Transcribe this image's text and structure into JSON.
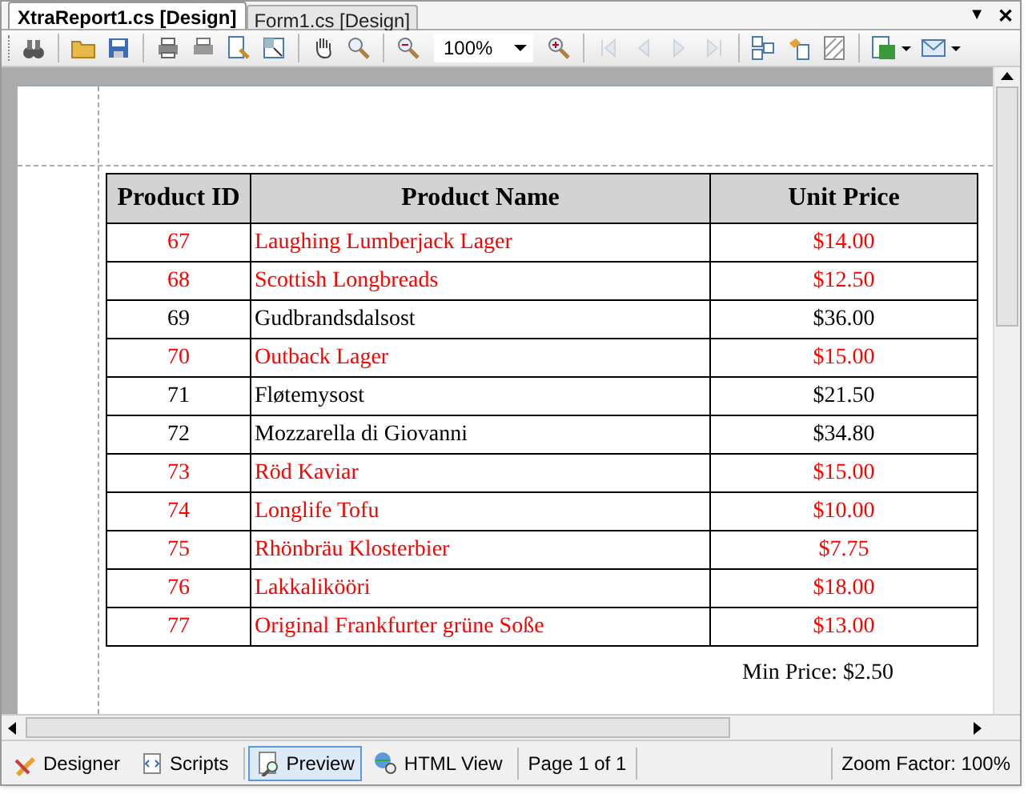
{
  "tabs": [
    {
      "label": "XtraReport1.cs [Design]",
      "selected": true
    },
    {
      "label": "Form1.cs [Design]",
      "selected": false
    }
  ],
  "tab_controls": {
    "menu": "▼",
    "close": "✕"
  },
  "toolbar": [
    {
      "kind": "button",
      "disabled": false
    },
    {
      "kind": "separator"
    },
    {
      "kind": "button",
      "disabled": false
    },
    {
      "kind": "button",
      "disabled": false
    },
    {
      "kind": "separator"
    },
    {
      "kind": "button",
      "disabled": false
    },
    {
      "kind": "button",
      "disabled": false
    },
    {
      "kind": "button",
      "disabled": false
    },
    {
      "kind": "button",
      "disabled": false
    },
    {
      "kind": "separator"
    },
    {
      "kind": "button",
      "disabled": false
    },
    {
      "kind": "button",
      "disabled": false
    },
    {
      "kind": "separator"
    },
    {
      "kind": "button",
      "disabled": false
    },
    {
      "kind": "combo",
      "value": "100%"
    },
    {
      "kind": "button",
      "disabled": false
    },
    {
      "kind": "separator"
    },
    {
      "kind": "button",
      "disabled": true
    },
    {
      "kind": "button",
      "disabled": true
    },
    {
      "kind": "button",
      "disabled": true
    },
    {
      "kind": "button",
      "disabled": true
    },
    {
      "kind": "separator"
    },
    {
      "kind": "button",
      "disabled": false
    },
    {
      "kind": "button",
      "disabled": false
    },
    {
      "kind": "button",
      "disabled": false
    },
    {
      "kind": "separator"
    },
    {
      "kind": "dropdown",
      "disabled": false
    },
    {
      "kind": "dropdown",
      "disabled": false
    }
  ],
  "table": {
    "columns": [
      "Product ID",
      "Product Name",
      "Unit Price"
    ],
    "rows": [
      {
        "id": "67",
        "name": "Laughing Lumberjack Lager",
        "price": "$14.00",
        "highlighted": true
      },
      {
        "id": "68",
        "name": "Scottish Longbreads",
        "price": "$12.50",
        "highlighted": true
      },
      {
        "id": "69",
        "name": "Gudbrandsdalsost",
        "price": "$36.00",
        "highlighted": false
      },
      {
        "id": "70",
        "name": "Outback Lager",
        "price": "$15.00",
        "highlighted": true
      },
      {
        "id": "71",
        "name": "Fløtemysost",
        "price": "$21.50",
        "highlighted": false
      },
      {
        "id": "72",
        "name": "Mozzarella di Giovanni",
        "price": "$34.80",
        "highlighted": false
      },
      {
        "id": "73",
        "name": "Röd Kaviar",
        "price": "$15.00",
        "highlighted": true
      },
      {
        "id": "74",
        "name": "Longlife Tofu",
        "price": "$10.00",
        "highlighted": true
      },
      {
        "id": "75",
        "name": "Rhönbräu Klosterbier",
        "price": "$7.75",
        "highlighted": true
      },
      {
        "id": "76",
        "name": "Lakkalikööri",
        "price": "$18.00",
        "highlighted": true
      },
      {
        "id": "77",
        "name": "Original Frankfurter grüne Soße",
        "price": "$13.00",
        "highlighted": true
      }
    ]
  },
  "summary": "Min Price: $2.50",
  "status_bar": {
    "views": [
      {
        "label": "Designer",
        "selected": false
      },
      {
        "label": "Scripts",
        "selected": false
      },
      {
        "label": "Preview",
        "selected": true
      },
      {
        "label": "HTML View",
        "selected": false
      }
    ],
    "page": "Page 1 of 1",
    "zoom": "Zoom Factor: 100%"
  }
}
